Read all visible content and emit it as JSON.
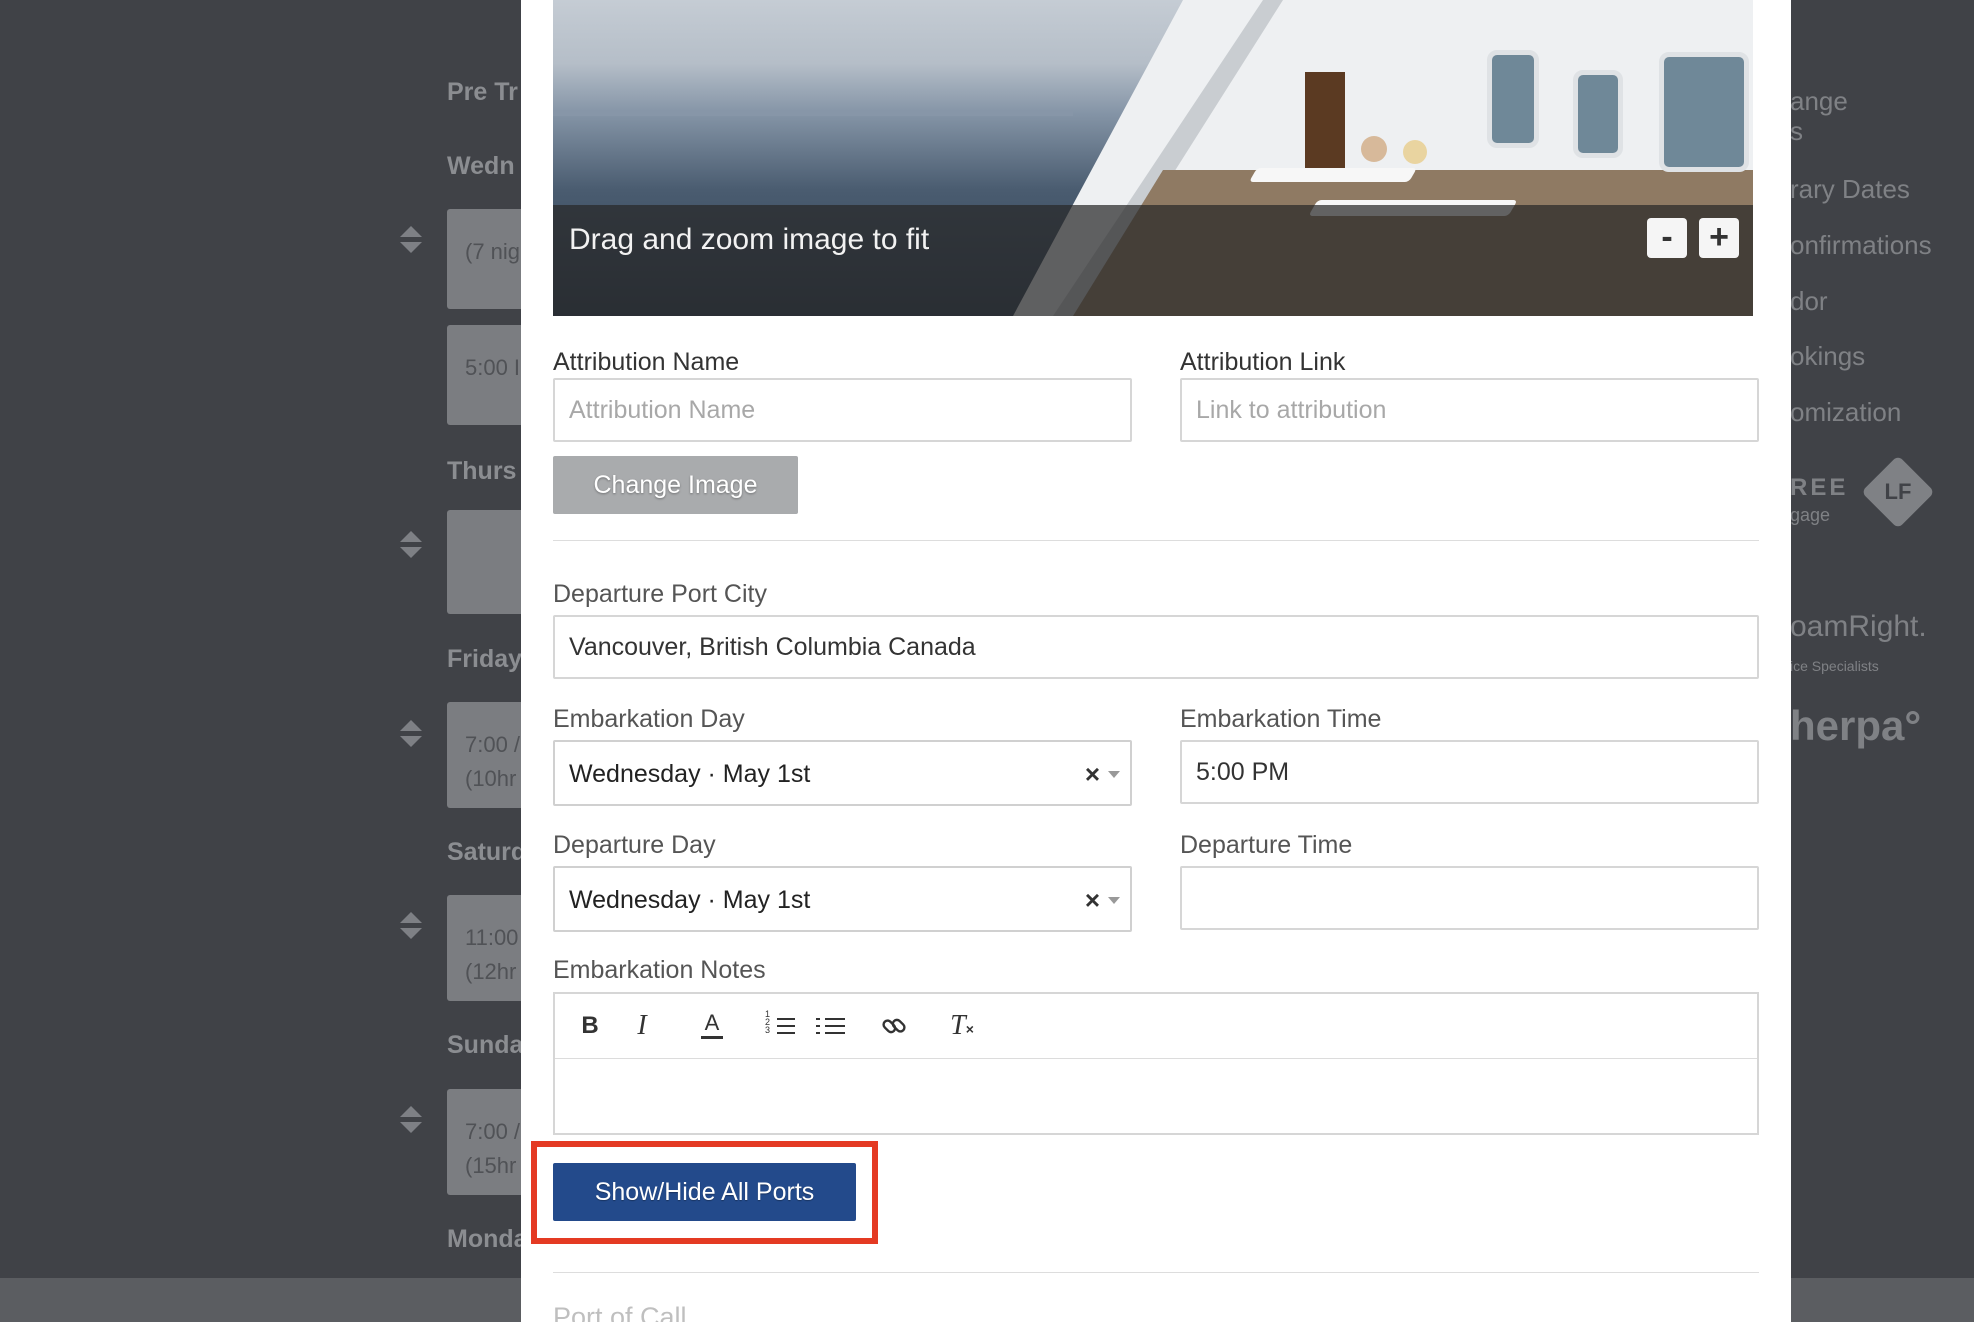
{
  "background": {
    "left_days": [
      "Pre Tr",
      "Wedn",
      "Thurs",
      "Friday",
      "Saturd",
      "Sunda",
      "Monda"
    ],
    "cards": [
      "(7 nig",
      "5:00 I",
      "",
      "7:00 /\n(10hr",
      "11:00\n(12hr",
      "7:00 /\n(15hr"
    ],
    "right_menu": [
      "ange\ns",
      "rary Dates",
      "onfirmations",
      "dor",
      "okings",
      "omization"
    ],
    "logos": [
      "REE",
      "gage",
      "LF",
      "oamRight.",
      "ice Specialists",
      "herpa°"
    ]
  },
  "image": {
    "overlay_text": "Drag and zoom image to fit",
    "zoom_out": "-",
    "zoom_in": "+"
  },
  "attribution": {
    "name_label": "Attribution Name",
    "name_placeholder": "Attribution Name",
    "name_value": "",
    "link_label": "Attribution Link",
    "link_placeholder": "Link to attribution",
    "link_value": ""
  },
  "change_image_label": "Change Image",
  "departure_port": {
    "label": "Departure Port City",
    "value": "Vancouver, British Columbia Canada"
  },
  "embarkation_day": {
    "label": "Embarkation Day",
    "value": "Wednesday · May 1st",
    "clear": "×"
  },
  "embarkation_time": {
    "label": "Embarkation Time",
    "value": "5:00 PM"
  },
  "departure_day": {
    "label": "Departure Day",
    "value": "Wednesday · May 1st",
    "clear": "×"
  },
  "departure_time": {
    "label": "Departure Time",
    "value": ""
  },
  "embarkation_notes": {
    "label": "Embarkation Notes",
    "toolbar": {
      "bold": "B",
      "italic": "I",
      "color": "A",
      "clear": "T"
    }
  },
  "show_hide_ports_label": "Show/Hide All Ports",
  "port_of_call_label": "Port of Call",
  "colors": {
    "primary_button": "#234a8b",
    "highlight": "#e43a23",
    "backdrop": "#404247"
  }
}
